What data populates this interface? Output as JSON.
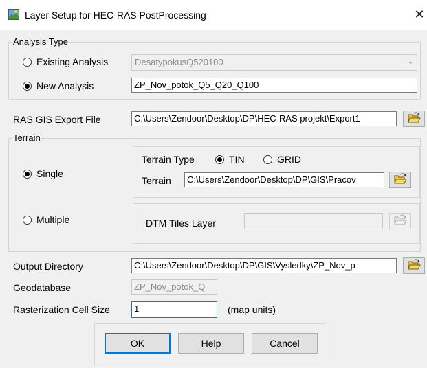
{
  "window": {
    "title": "Layer Setup for HEC-RAS PostProcessing",
    "close_glyph": "✕"
  },
  "analysis_type": {
    "legend": "Analysis Type",
    "existing_label": "Existing Analysis",
    "existing_value": "DesatypokusQ520100",
    "new_label": "New Analysis",
    "new_value": "ZP_Nov_potok_Q5_Q20_Q100",
    "selected": "new"
  },
  "ras_export": {
    "label": "RAS GIS Export File",
    "value": "C:\\Users\\Zendoor\\Desktop\\DP\\HEC-RAS projekt\\Export1"
  },
  "terrain": {
    "legend": "Terrain",
    "single_label": "Single",
    "multiple_label": "Multiple",
    "selected": "single",
    "type_label": "Terrain Type",
    "tin_label": "TIN",
    "grid_label": "GRID",
    "type_selected": "tin",
    "terrain_label": "Terrain",
    "terrain_value": "C:\\Users\\Zendoor\\Desktop\\DP\\GIS\\Pracov",
    "dtm_label": "DTM Tiles Layer",
    "dtm_value": ""
  },
  "output": {
    "dir_label": "Output Directory",
    "dir_value": "C:\\Users\\Zendoor\\Desktop\\DP\\GIS\\Vysledky\\ZP_Nov_p",
    "gdb_label": "Geodatabase",
    "gdb_value": "ZP_Nov_potok_Q",
    "cell_label": "Rasterization Cell Size",
    "cell_value": "1",
    "units_label": "(map units)"
  },
  "buttons": {
    "ok": "OK",
    "help": "Help",
    "cancel": "Cancel"
  },
  "colors": {
    "accent": "#0078d7",
    "dialog_bg": "#f0f0f0",
    "folder_yellow": "#f2c230"
  }
}
